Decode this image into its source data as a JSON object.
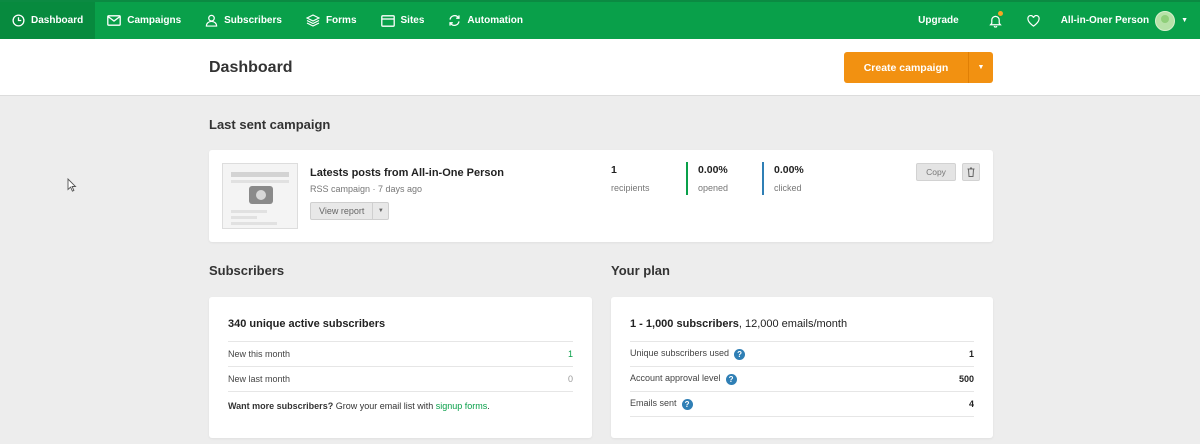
{
  "nav": {
    "items": [
      {
        "label": "Dashboard",
        "icon": "clock-icon"
      },
      {
        "label": "Campaigns",
        "icon": "envelope-icon"
      },
      {
        "label": "Subscribers",
        "icon": "user-icon"
      },
      {
        "label": "Forms",
        "icon": "layers-icon"
      },
      {
        "label": "Sites",
        "icon": "browser-window-icon"
      },
      {
        "label": "Automation",
        "icon": "refresh-icon"
      }
    ],
    "upgrade": "Upgrade",
    "user_name": "All-in-Oner Person"
  },
  "header": {
    "title": "Dashboard",
    "create_campaign": "Create campaign"
  },
  "last_campaign": {
    "section_title": "Last sent campaign",
    "title": "Latests posts from All-in-One Person",
    "subtitle": "RSS campaign · 7 days ago",
    "view_report": "View report",
    "stats": [
      {
        "value": "1",
        "label": "recipients"
      },
      {
        "value": "0.00%",
        "label": "opened"
      },
      {
        "value": "0.00%",
        "label": "clicked"
      }
    ],
    "copy": "Copy"
  },
  "subscribers": {
    "section_title": "Subscribers",
    "heading": "340 unique active subscribers",
    "rows": [
      {
        "label": "New this month",
        "value": "1"
      },
      {
        "label": "New last month",
        "value": "0"
      }
    ],
    "promo_bold": "Want more subscribers?",
    "promo_text": " Grow your email list with ",
    "promo_link": "signup forms",
    "promo_end": "."
  },
  "plan": {
    "section_title": "Your plan",
    "heading_bold": "1 - 1,000 subscribers",
    "heading_rest": ", 12,000 emails/month",
    "rows": [
      {
        "label": "Unique subscribers used",
        "value": "1"
      },
      {
        "label": "Account approval level",
        "value": "500"
      },
      {
        "label": "Emails sent",
        "value": "4"
      }
    ]
  },
  "colors": {
    "brand_green": "#09a04a",
    "accent_orange": "#f29111",
    "opened_bar": "#09a04a",
    "clicked_bar": "#2f7fb5"
  }
}
